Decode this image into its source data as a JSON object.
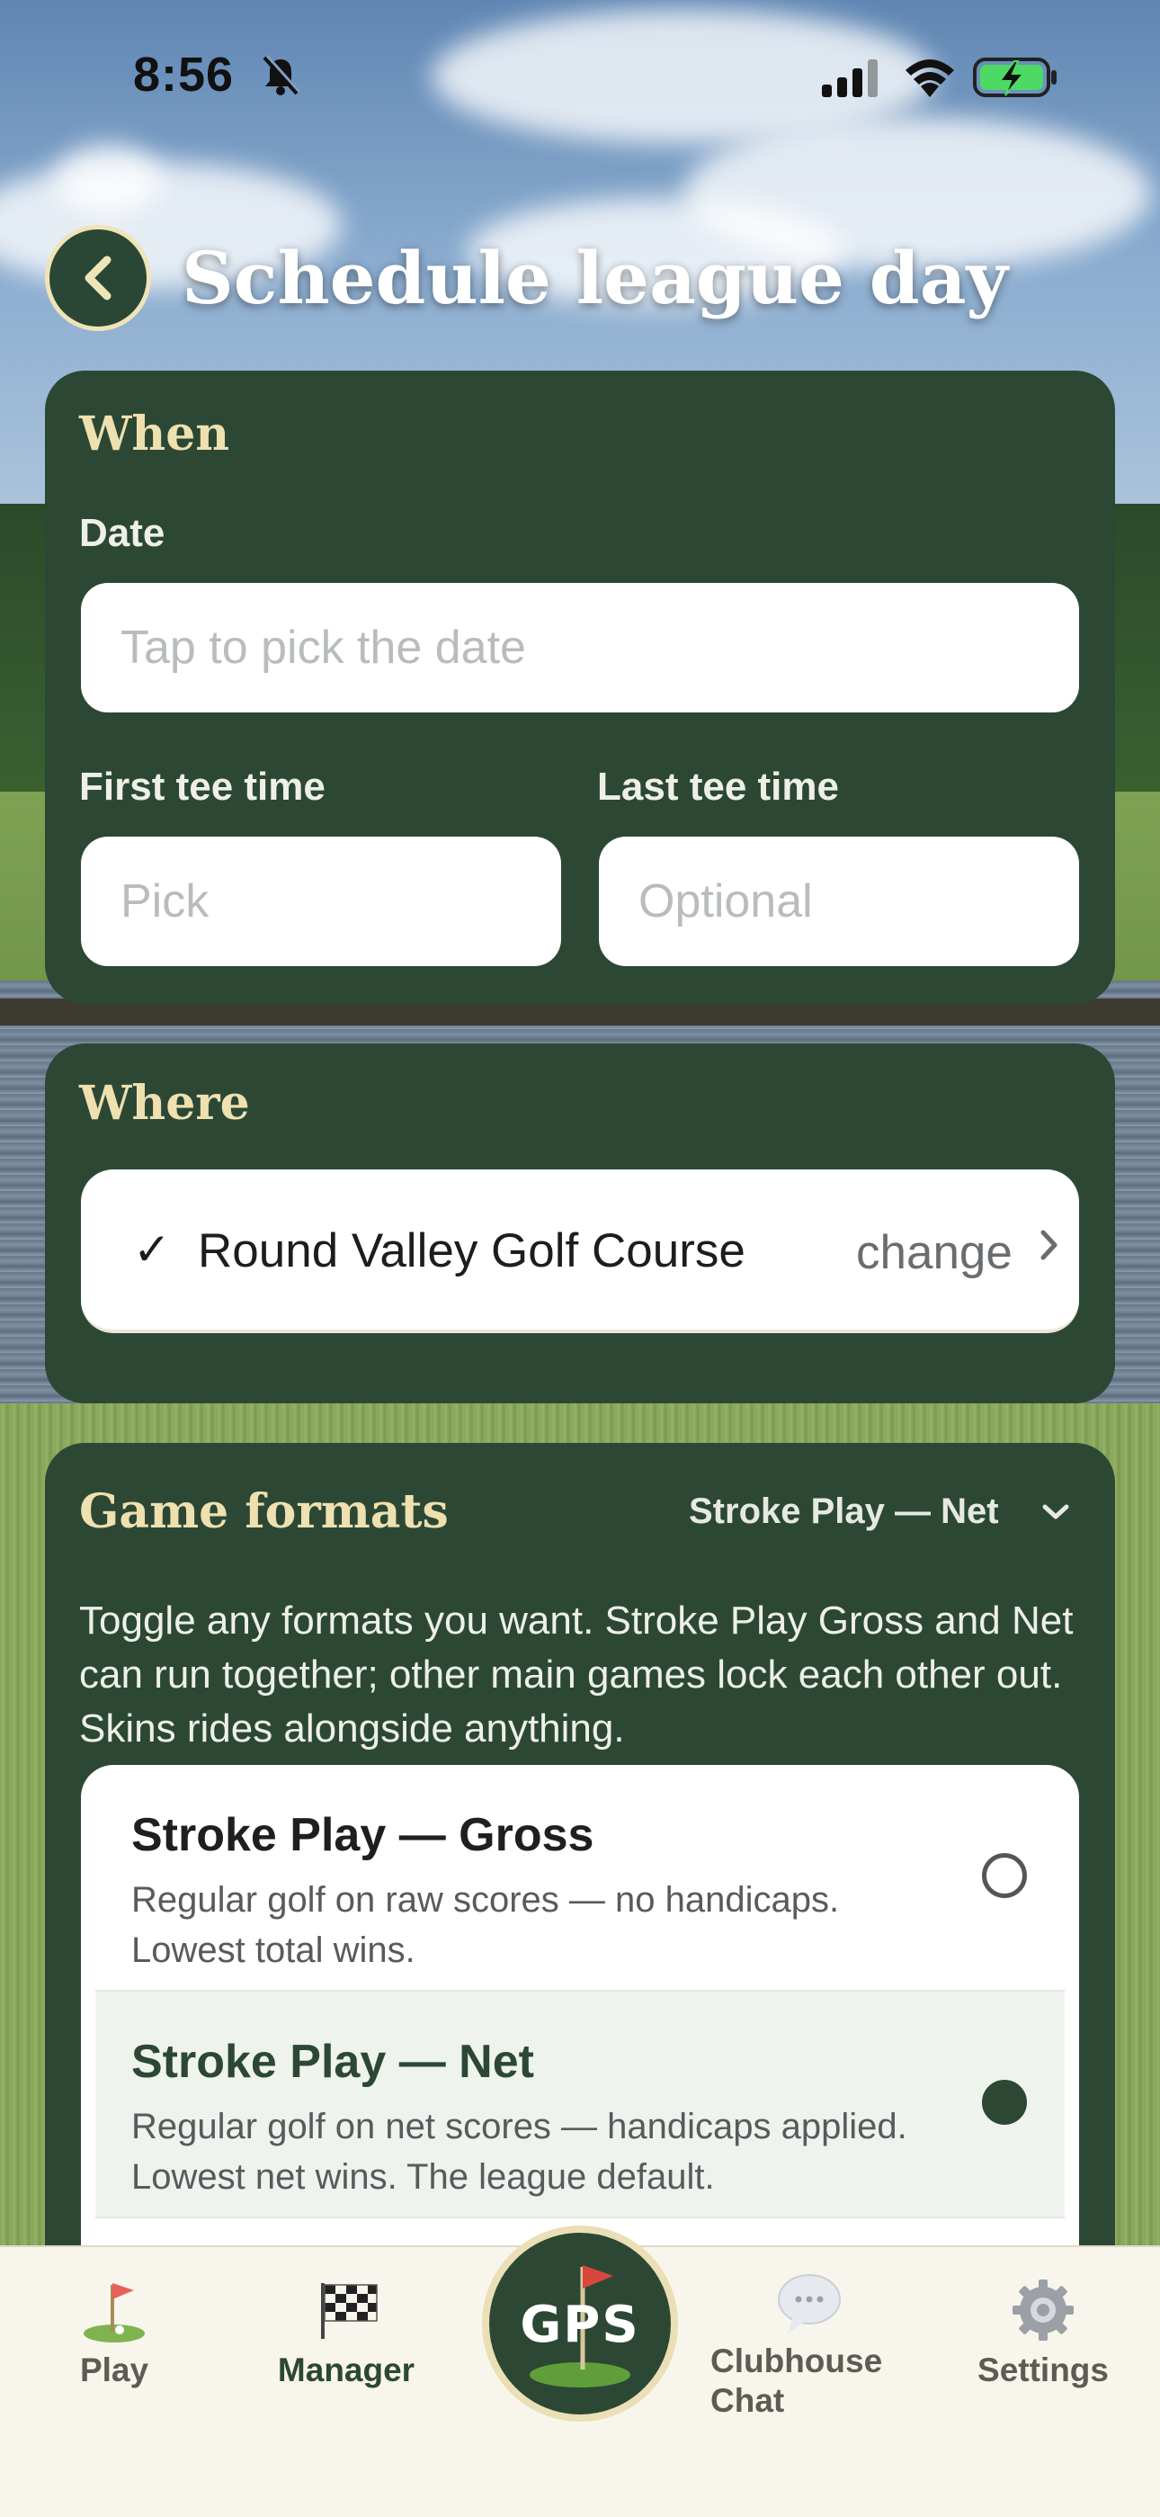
{
  "status_bar": {
    "time": "8:56"
  },
  "header": {
    "title": "Schedule league day"
  },
  "when": {
    "title": "When",
    "date_label": "Date",
    "date_placeholder": "Tap to pick the date",
    "first_tee_label": "First tee time",
    "first_tee_placeholder": "Pick",
    "last_tee_label": "Last tee time",
    "last_tee_placeholder": "Optional"
  },
  "where": {
    "title": "Where",
    "course_check": "✓",
    "course_name": "Round Valley Golf Course",
    "change_label": "change"
  },
  "formats": {
    "title": "Game formats",
    "selected": "Stroke Play — Net",
    "description": "Toggle any formats you want. Stroke Play Gross and Net can run together; other main games lock each other out. Skins rides alongside anything.",
    "options": [
      {
        "title": "Stroke Play — Gross",
        "description": "Regular golf on raw scores — no handicaps. Lowest total wins.",
        "selected": false
      },
      {
        "title": "Stroke Play — Net",
        "description": "Regular golf on net scores — handicaps applied. Lowest net wins. The league default.",
        "selected": true
      }
    ]
  },
  "tabbar": {
    "play": "Play",
    "manager": "Manager",
    "gps": "GPS",
    "clubhouse_line1": "Clubhouse",
    "clubhouse_line2": "Chat",
    "settings": "Settings"
  },
  "colors": {
    "card": "#2c4835",
    "card_title": "#efe0b0",
    "tabbar": "#f8f5ec"
  }
}
